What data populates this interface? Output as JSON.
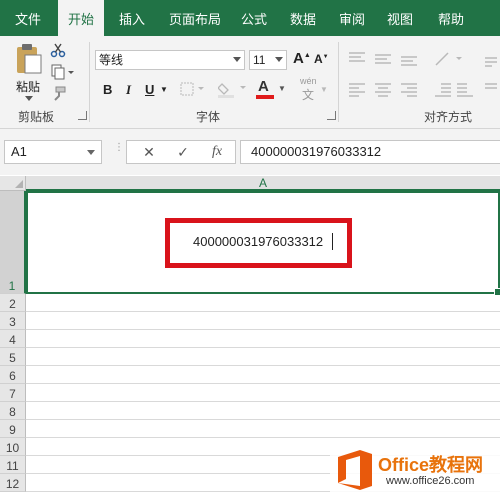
{
  "ribbon": {
    "tabs": [
      "文件",
      "开始",
      "插入",
      "页面布局",
      "公式",
      "数据",
      "审阅",
      "视图",
      "帮助"
    ],
    "active_tab": "开始",
    "clipboard": {
      "paste_label": "粘贴",
      "group_label": "剪贴板"
    },
    "font": {
      "font_name": "等线",
      "font_size": "11",
      "group_label": "字体",
      "bold": "B",
      "italic": "I",
      "underline": "U",
      "font_color_letter": "A",
      "grow": "A",
      "shrink": "A",
      "phonetic": "wén"
    },
    "alignment": {
      "group_label": "对齐方式"
    },
    "accent_color": "#217346"
  },
  "formula_bar": {
    "name_box": "A1",
    "cancel_icon": "✕",
    "enter_icon": "✓",
    "fx_label": "fx",
    "content": "400000031976033312"
  },
  "sheet": {
    "column_header": "A",
    "row_numbers": [
      "1",
      "2",
      "3",
      "4",
      "5",
      "6",
      "7",
      "8",
      "9",
      "10",
      "11",
      "12"
    ],
    "cell_a1": "400000031976033312",
    "highlight_color": "#d9131b"
  },
  "watermark": {
    "title": "Office教程网",
    "subtitle": "www.office26.com"
  }
}
